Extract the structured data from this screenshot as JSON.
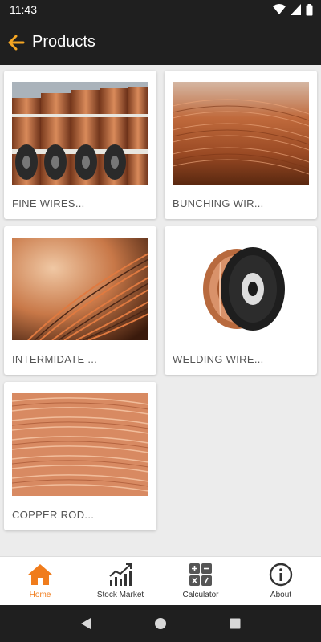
{
  "status_bar": {
    "time": "11:43"
  },
  "app_bar": {
    "title": "Products"
  },
  "products": [
    {
      "label": "FINE WIRES..."
    },
    {
      "label": "BUNCHING WIR..."
    },
    {
      "label": "INTERMIDATE ..."
    },
    {
      "label": "WELDING WIRE..."
    },
    {
      "label": "COPPER ROD..."
    }
  ],
  "bottom_nav": {
    "items": [
      {
        "label": "Home",
        "icon": "home-icon",
        "active": true
      },
      {
        "label": "Stock Market",
        "icon": "chart-icon",
        "active": false
      },
      {
        "label": "Calculator",
        "icon": "calculator-icon",
        "active": false
      },
      {
        "label": "About",
        "icon": "info-icon",
        "active": false
      }
    ]
  },
  "colors": {
    "accent": "#f07c1c",
    "bar": "#1f1f1f",
    "background": "#ececec"
  }
}
